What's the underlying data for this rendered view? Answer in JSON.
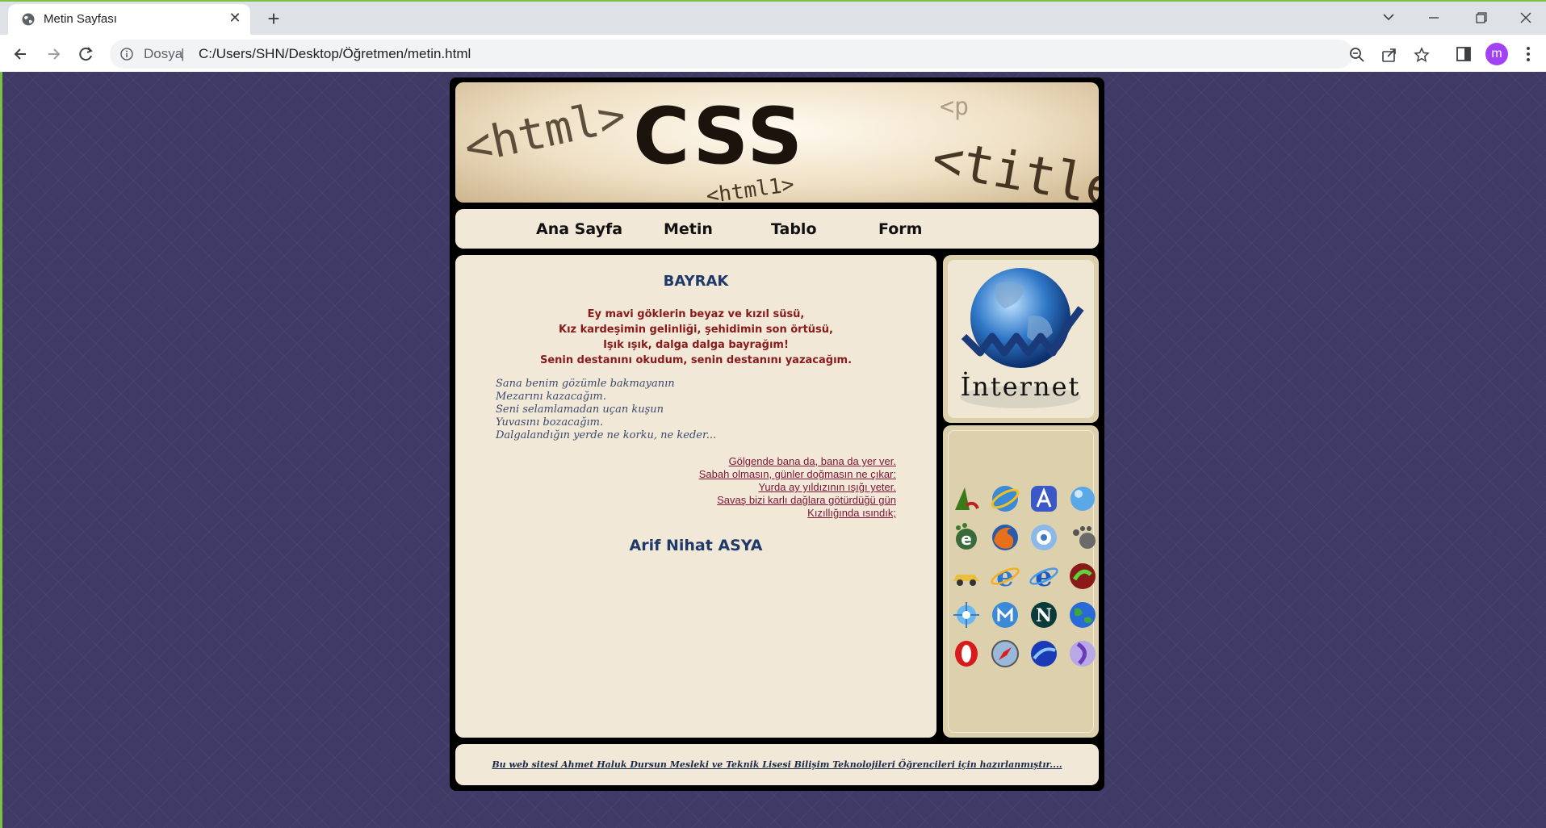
{
  "browser": {
    "tab_title": "Metin Sayfası",
    "scheme_label": "Dosya",
    "separator": "|",
    "url": "C:/Users/SHN/Desktop/Öğretmen/metin.html",
    "avatar_letter": "m",
    "accent": "#7bc142"
  },
  "nav": {
    "items": [
      "Ana Sayfa",
      "Metin",
      "Tablo",
      "Form"
    ]
  },
  "header": {
    "banner_text": "CSS",
    "tag_html": "<html>",
    "tag_html_small": "<html1>",
    "tag_title": "<title>",
    "tag_p": "<p"
  },
  "poem": {
    "title": "BAYRAK",
    "stanza1": [
      "Ey mavi göklerin beyaz ve kızıl süsü,",
      "Kız kardeşimin gelinliği, şehidimin son örtüsü,",
      "Işık ışık, dalga dalga bayrağım!",
      "Senin destanını okudum, senin destanını yazacağım."
    ],
    "stanza2": [
      "Sana benim gözümle bakmayanın",
      "Mezarını kazacağım.",
      "Seni selamlamadan uçan kuşun",
      "Yuvasını bozacağım.",
      "Dalgalandığın yerde ne korku, ne keder..."
    ],
    "stanza3": [
      "Gölgende bana da, bana da yer ver.",
      "Sabah olmasın, günler doğmasın ne çıkar:",
      "Yurda ay yıldızının ışığı yeter.",
      "Savaş bizi karlı dağlara götürdüğü gün",
      "Kızıllığında ısındık;"
    ],
    "author": "Arif Nihat ASYA"
  },
  "sidebar": {
    "internet_label": "İnternet",
    "icons": [
      "aol-icon",
      "ie-classic-icon",
      "avant-icon",
      "globe-blue-icon",
      "epiphany-icon",
      "firefox-icon",
      "k-meleon-icon",
      "galeon-icon",
      "car-icon",
      "ie-icon",
      "ie-blue-icon",
      "green-circle-icon",
      "kmeleon-icon",
      "maxthon-icon",
      "netscape-icon",
      "earth-icon",
      "opera-icon",
      "safari-icon",
      "seamonkey-icon",
      "purple-icon"
    ]
  },
  "footer": {
    "text": "Bu web sitesi Ahmet Haluk Dursun Mesleki ve Teknik Lisesi Bilişim Teknolojileri Öğrencileri için hazırlanmıştır...."
  }
}
